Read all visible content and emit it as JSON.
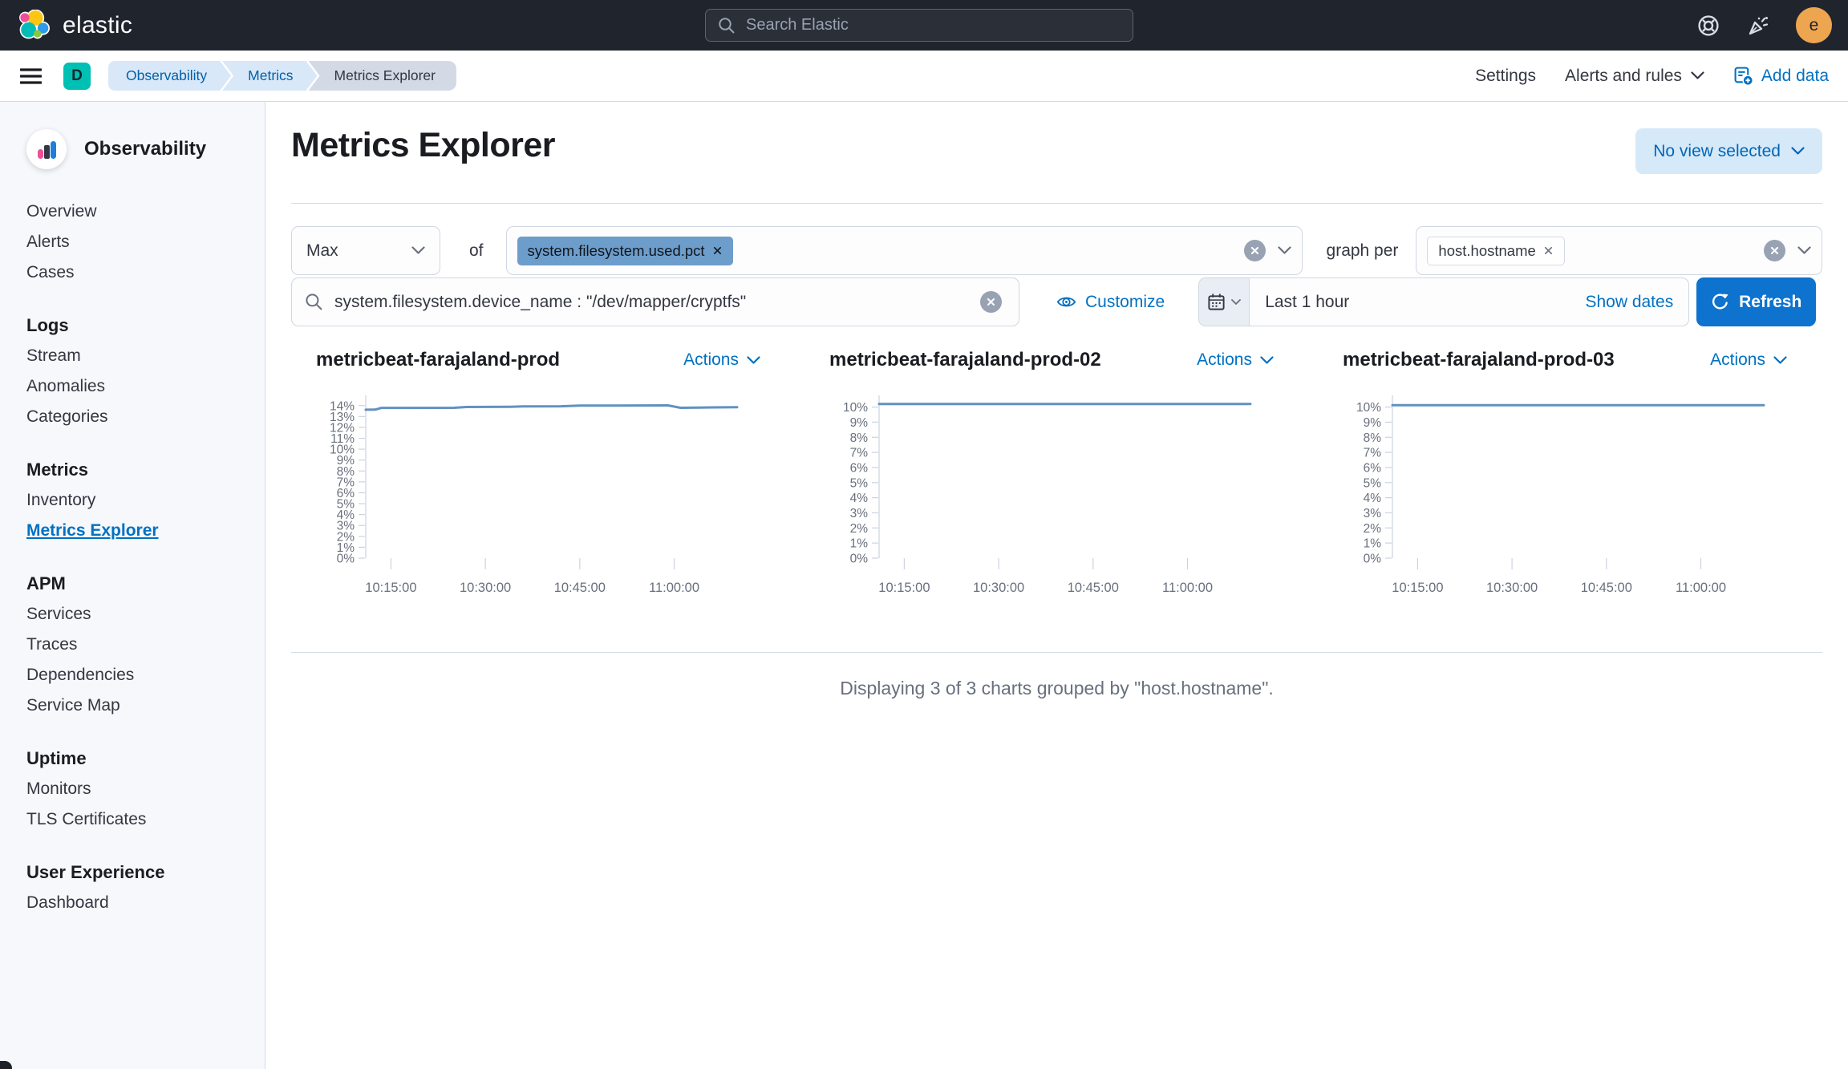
{
  "header": {
    "brand": "elastic",
    "search_placeholder": "Search Elastic",
    "avatar_initial": "e"
  },
  "breadcrumb_bar": {
    "space_initial": "D",
    "breadcrumbs": [
      {
        "label": "Observability",
        "current": false
      },
      {
        "label": "Metrics",
        "current": false
      },
      {
        "label": "Metrics Explorer",
        "current": true
      }
    ],
    "settings_label": "Settings",
    "alerts_and_rules_label": "Alerts and rules",
    "add_data_label": "Add data"
  },
  "sidebar": {
    "title": "Observability",
    "sections": [
      {
        "heading": "",
        "items": [
          {
            "label": "Overview"
          },
          {
            "label": "Alerts"
          },
          {
            "label": "Cases"
          }
        ]
      },
      {
        "heading": "Logs",
        "items": [
          {
            "label": "Stream"
          },
          {
            "label": "Anomalies"
          },
          {
            "label": "Categories"
          }
        ]
      },
      {
        "heading": "Metrics",
        "items": [
          {
            "label": "Inventory"
          },
          {
            "label": "Metrics Explorer",
            "active": true
          }
        ]
      },
      {
        "heading": "APM",
        "items": [
          {
            "label": "Services"
          },
          {
            "label": "Traces"
          },
          {
            "label": "Dependencies"
          },
          {
            "label": "Service Map"
          }
        ]
      },
      {
        "heading": "Uptime",
        "items": [
          {
            "label": "Monitors"
          },
          {
            "label": "TLS Certificates"
          }
        ]
      },
      {
        "heading": "User Experience",
        "items": [
          {
            "label": "Dashboard"
          }
        ]
      }
    ]
  },
  "page": {
    "title": "Metrics Explorer",
    "view_selector_label": "No view selected",
    "summary": "Displaying 3 of 3 charts grouped by \"host.hostname\"."
  },
  "toolbar": {
    "aggregation_value": "Max",
    "of_label": "of",
    "metric_field_badge": "system.filesystem.used.pct",
    "graph_per_label": "graph per",
    "group_by_badge": "host.hostname",
    "query_value": "system.filesystem.device_name : \"/dev/mapper/cryptfs\"",
    "customize_label": "Customize",
    "time_range_value": "Last 1 hour",
    "show_dates_label": "Show dates",
    "refresh_label": "Refresh"
  },
  "charts_common": {
    "actions_label": "Actions",
    "y_suffix": "%"
  },
  "chart_data": [
    {
      "type": "line",
      "title": "metricbeat-farajaland-prod",
      "ylim": [
        0,
        14.35
      ],
      "ytick_max": 14,
      "ytick_step": 1,
      "xlim": [
        0,
        59
      ],
      "xticks": [
        {
          "label": "10:15:00",
          "t": 4
        },
        {
          "label": "10:30:00",
          "t": 19
        },
        {
          "label": "10:45:00",
          "t": 34
        },
        {
          "label": "11:00:00",
          "t": 49
        }
      ],
      "grid": false,
      "legend": "none",
      "series": [
        {
          "color": "#6092C0",
          "points": [
            [
              0,
              13.62
            ],
            [
              1.5,
              13.63
            ],
            [
              2.5,
              13.79
            ],
            [
              14,
              13.8
            ],
            [
              16,
              13.87
            ],
            [
              23,
              13.89
            ],
            [
              25,
              13.93
            ],
            [
              31,
              13.94
            ],
            [
              34,
              14.0
            ],
            [
              48,
              14.02
            ],
            [
              50,
              13.8
            ],
            [
              53,
              13.82
            ],
            [
              59,
              13.85
            ]
          ]
        }
      ]
    },
    {
      "type": "line",
      "title": "metricbeat-farajaland-prod-02",
      "ylim": [
        0,
        10.35
      ],
      "ytick_max": 10,
      "ytick_step": 1,
      "xlim": [
        0,
        59
      ],
      "xticks": [
        {
          "label": "10:15:00",
          "t": 4
        },
        {
          "label": "10:30:00",
          "t": 19
        },
        {
          "label": "10:45:00",
          "t": 34
        },
        {
          "label": "11:00:00",
          "t": 49
        }
      ],
      "grid": false,
      "legend": "none",
      "series": [
        {
          "color": "#6092C0",
          "points": [
            [
              0,
              10.2
            ],
            [
              59,
              10.2
            ]
          ]
        }
      ]
    },
    {
      "type": "line",
      "title": "metricbeat-farajaland-prod-03",
      "ylim": [
        0,
        10.35
      ],
      "ytick_max": 10,
      "ytick_step": 1,
      "xlim": [
        0,
        59
      ],
      "xticks": [
        {
          "label": "10:15:00",
          "t": 4
        },
        {
          "label": "10:30:00",
          "t": 19
        },
        {
          "label": "10:45:00",
          "t": 34
        },
        {
          "label": "11:00:00",
          "t": 49
        }
      ],
      "grid": false,
      "legend": "none",
      "series": [
        {
          "color": "#6092C0",
          "points": [
            [
              0,
              10.12
            ],
            [
              59,
              10.12
            ]
          ]
        }
      ]
    }
  ],
  "colors": {
    "primary": "#0071C2",
    "chart_line": "#6092C0",
    "metric_badge_bg": "#6D9DCB",
    "space_badge_bg": "#00BFB3",
    "header_bg": "#20242D",
    "avatar_bg": "#EDA550",
    "crumb_blue_bg": "#D9E8F8",
    "crumb_gray_bg": "#D3DAE6",
    "refresh_button_bg": "#0E72CF",
    "axis_text": "#69707D"
  },
  "icons": [
    "elastic-logo-icon",
    "search-icon",
    "help-icon",
    "celebration-icon",
    "menu-icon",
    "chevron-down-icon",
    "add-data-icon",
    "observability-logo-icon",
    "clear-icon",
    "remove-badge-icon",
    "customize-eye-icon",
    "calendar-icon",
    "refresh-icon"
  ]
}
